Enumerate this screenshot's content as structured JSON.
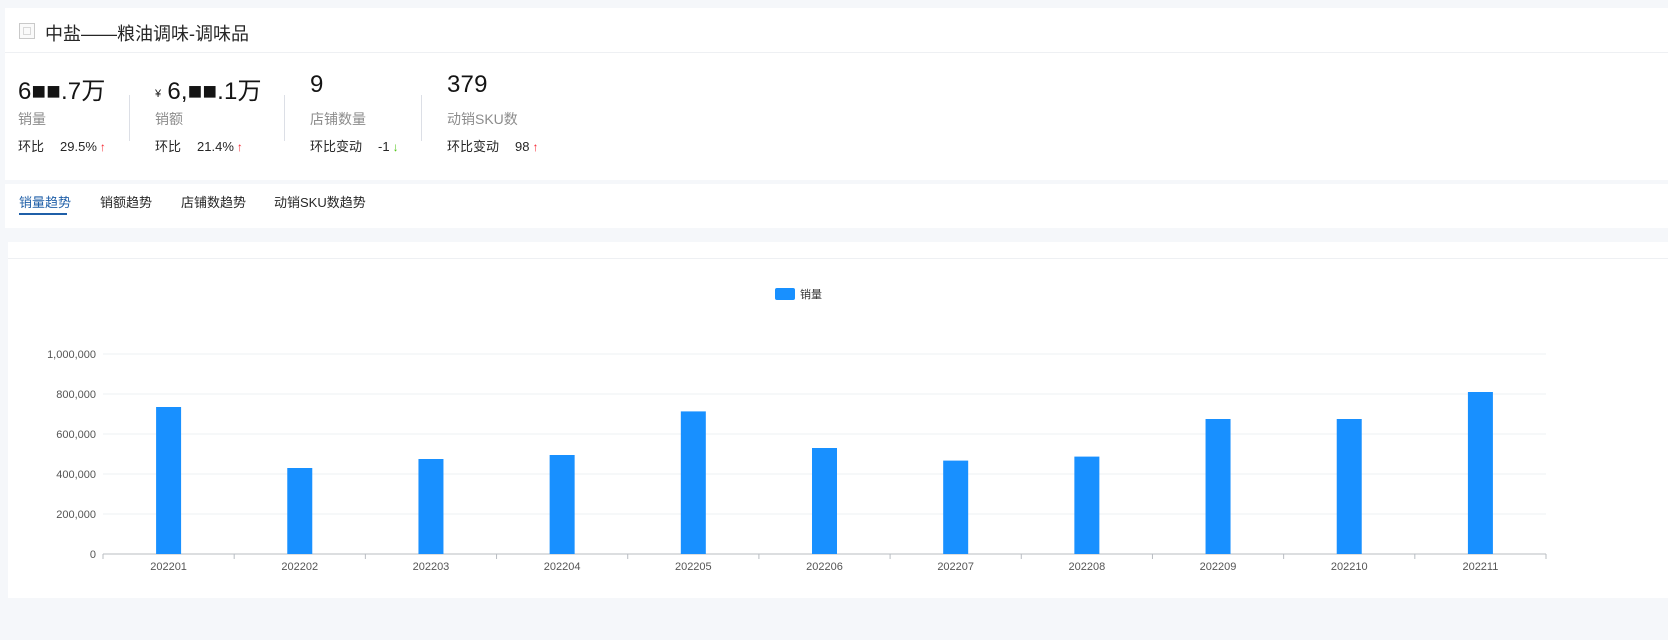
{
  "header": {
    "title": "中盐——粮油调味-调味品"
  },
  "kpis": [
    {
      "value": "6■■.7万",
      "prefix": "",
      "label": "销量",
      "change_label": "环比",
      "change_value": "29.5%",
      "direction": "up"
    },
    {
      "value": "6,■■.1万",
      "prefix": "¥",
      "label": "销额",
      "change_label": "环比",
      "change_value": "21.4%",
      "direction": "up"
    },
    {
      "value": "9",
      "prefix": "",
      "label": "店铺数量",
      "change_label": "环比变动",
      "change_value": "-1",
      "direction": "down"
    },
    {
      "value": "379",
      "prefix": "",
      "label": "动销SKU数",
      "change_label": "环比变动",
      "change_value": "98",
      "direction": "up"
    }
  ],
  "arrows": {
    "up": "↑",
    "down": "↓"
  },
  "tabs": [
    "销量趋势",
    "销额趋势",
    "店铺数趋势",
    "动销SKU数趋势"
  ],
  "active_tab": 0,
  "colors": {
    "bar": "#1890ff",
    "accent": "#1f5fa8",
    "up": "#f5222d",
    "down": "#52c41a"
  },
  "chart_data": {
    "type": "bar",
    "categories": [
      "202201",
      "202202",
      "202203",
      "202204",
      "202205",
      "202206",
      "202207",
      "202208",
      "202209",
      "202210",
      "202211"
    ],
    "series": [
      {
        "name": "销量",
        "values": [
          735000,
          430000,
          475000,
          495000,
          713000,
          530000,
          467000,
          487000,
          675000,
          675000,
          810000
        ]
      }
    ],
    "ylim": [
      0,
      1000000
    ],
    "yticks": [
      "0",
      "200,000",
      "400,000",
      "600,000",
      "800,000",
      "1,000,000"
    ],
    "grid": true,
    "legend": "top-center"
  }
}
